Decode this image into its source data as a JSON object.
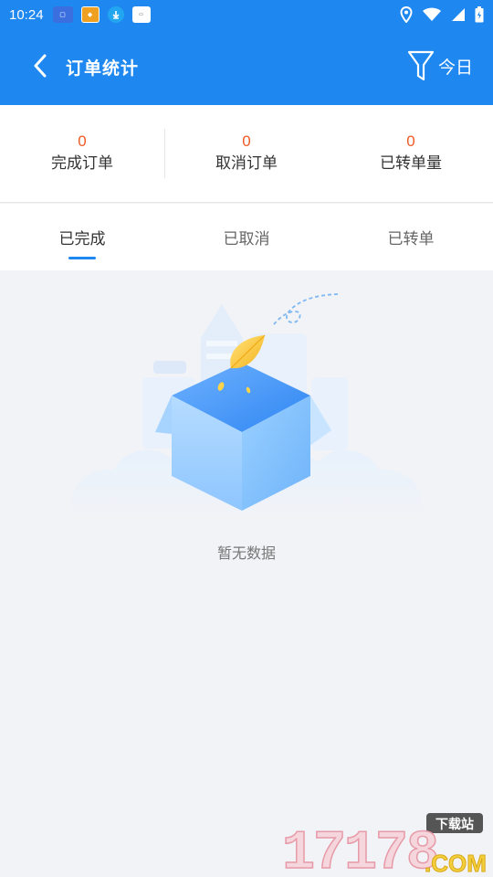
{
  "status_bar": {
    "time": "10:24",
    "notification_icons": [
      "app-notification-icon-1",
      "app-notification-icon-2",
      "download-icon",
      "app-notification-icon-3"
    ],
    "system_icons": [
      "location-icon",
      "wifi-icon",
      "signal-icon",
      "battery-icon"
    ]
  },
  "app_bar": {
    "title": "订单统计",
    "filter_label": "今日",
    "background": "#1e88f0"
  },
  "stats": [
    {
      "value": "0",
      "label": "完成订单"
    },
    {
      "value": "0",
      "label": "取消订单"
    },
    {
      "value": "0",
      "label": "已转单量"
    }
  ],
  "tabs": [
    {
      "label": "已完成",
      "active": true
    },
    {
      "label": "已取消",
      "active": false
    },
    {
      "label": "已转单",
      "active": false
    }
  ],
  "empty_state": {
    "message": "暂无数据"
  },
  "watermark": {
    "number": "17178",
    "tag": "下载站",
    "domain": ".COM"
  },
  "colors": {
    "accent": "#1e88f0",
    "stat_value": "#f05a28",
    "background": "#f2f3f7"
  }
}
